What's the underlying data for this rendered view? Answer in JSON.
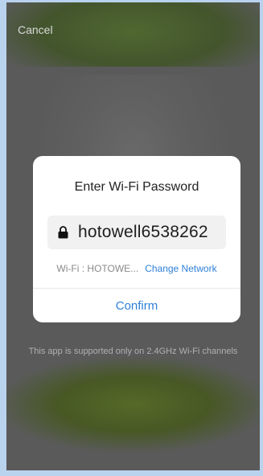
{
  "header": {
    "cancel_label": "Cancel"
  },
  "dialog": {
    "title": "Enter Wi-Fi Password",
    "password_value": "hotowell6538262",
    "wifi_label": "Wi-Fi : HOTOWE...",
    "change_network_label": "Change Network",
    "confirm_label": "Confirm"
  },
  "footer": {
    "support_note": "This app is supported only on 2.4GHz Wi-Fi channels"
  },
  "icons": {
    "lock": "lock-icon"
  },
  "colors": {
    "accent": "#2f80d8",
    "overlay": "#5a5a5a",
    "dialog_bg": "#ffffff"
  }
}
